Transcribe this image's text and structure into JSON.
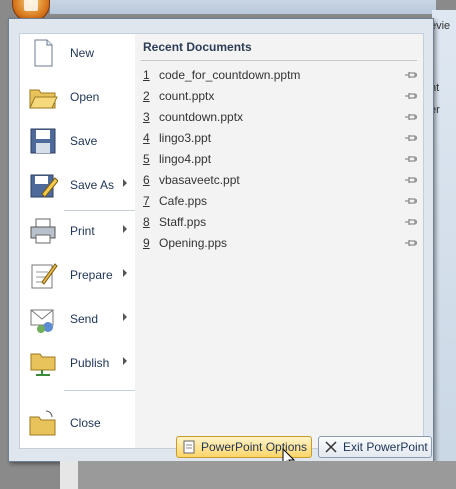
{
  "right_strip": {
    "top_text": "evie",
    "mid_text": "nt",
    "low_text": "er"
  },
  "menu_items": [
    {
      "id": "new",
      "label": "New",
      "icon": "new-document-icon",
      "submenu": false
    },
    {
      "id": "open",
      "label": "Open",
      "icon": "open-folder-icon",
      "submenu": false
    },
    {
      "id": "save",
      "label": "Save",
      "icon": "floppy-disk-icon",
      "submenu": false
    },
    {
      "id": "save-as",
      "label": "Save As",
      "icon": "save-as-icon",
      "submenu": true
    },
    {
      "id": "print",
      "label": "Print",
      "icon": "printer-icon",
      "submenu": true
    },
    {
      "id": "prepare",
      "label": "Prepare",
      "icon": "prepare-icon",
      "submenu": true
    },
    {
      "id": "send",
      "label": "Send",
      "icon": "send-icon",
      "submenu": true
    },
    {
      "id": "publish",
      "label": "Publish",
      "icon": "publish-icon",
      "submenu": true
    },
    {
      "id": "close",
      "label": "Close",
      "icon": "close-folder-icon",
      "submenu": false
    }
  ],
  "recent": {
    "title": "Recent Documents",
    "items": [
      {
        "num": "1",
        "name": "code_for_countdown.pptm"
      },
      {
        "num": "2",
        "name": "count.pptx"
      },
      {
        "num": "3",
        "name": "countdown.pptx"
      },
      {
        "num": "4",
        "name": "lingo3.ppt"
      },
      {
        "num": "5",
        "name": "lingo4.ppt"
      },
      {
        "num": "6",
        "name": "vbasaveetc.ppt"
      },
      {
        "num": "7",
        "name": "Cafe.pps"
      },
      {
        "num": "8",
        "name": "Staff.pps"
      },
      {
        "num": "9",
        "name": "Opening.pps"
      }
    ]
  },
  "bottom": {
    "options_label": "PowerPoint Options",
    "exit_label": "Exit PowerPoint"
  },
  "colors": {
    "accent": "#ffd56a",
    "text": "#1e3456"
  }
}
